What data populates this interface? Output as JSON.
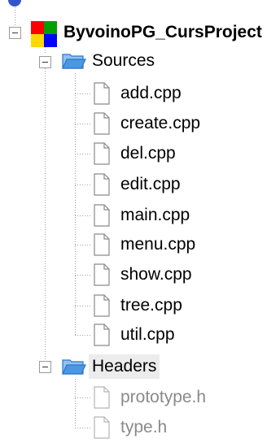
{
  "project": {
    "name": "ByvoinoPG_CursProject",
    "icon": "project-colored-squares-icon",
    "colors": [
      "#ff0000",
      "#00a000",
      "#ffd800",
      "#0000ff"
    ]
  },
  "sources": {
    "label": "Sources",
    "icon": "folder-open-icon",
    "files": [
      "add.cpp",
      "create.cpp",
      "del.cpp",
      "edit.cpp",
      "main.cpp",
      "menu.cpp",
      "show.cpp",
      "tree.cpp",
      "util.cpp"
    ]
  },
  "headers": {
    "label": "Headers",
    "icon": "folder-open-icon",
    "files": [
      "prototype.h",
      "type.h"
    ]
  },
  "colors": {
    "folder_blue": "#3c8ad8",
    "tree_line": "#a0a0a0",
    "dim_text": "#8a8a8a"
  }
}
